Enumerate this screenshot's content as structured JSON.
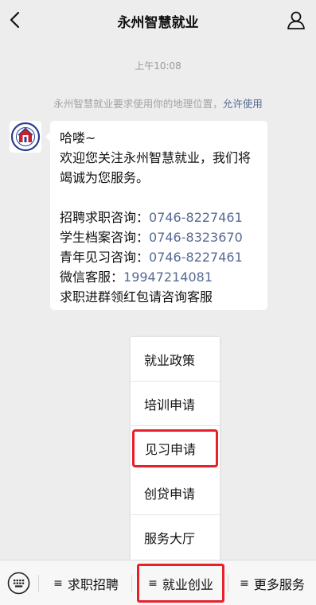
{
  "header": {
    "title": "永州智慧就业"
  },
  "chat": {
    "time": "上午10:08",
    "system_message": "永州智慧就业要求使用你的地理位置，",
    "system_action": "允许使用",
    "bubble": {
      "greeting": "哈喽~",
      "welcome_1": "欢迎您关注永州智慧就业，我们将",
      "welcome_2": "竭诚为您服务。",
      "lines": [
        {
          "label": "招聘求职咨询：",
          "value": "0746-8227461"
        },
        {
          "label": "学生档案咨询：",
          "value": "0746-8323670"
        },
        {
          "label": "青年见习咨询：",
          "value": "0746-8227461"
        },
        {
          "label": "微信客服：",
          "value": "19947214081"
        }
      ],
      "footer": "求职进群领红包请咨询客服"
    }
  },
  "submenu": {
    "items": [
      "就业政策",
      "培训申请",
      "见习申请",
      "创贷申请",
      "服务大厅"
    ]
  },
  "bottom_menu": {
    "tabs": [
      "求职招聘",
      "就业创业",
      "更多服务"
    ],
    "menu_glyph": "≡"
  },
  "colors": {
    "highlight": "#e8202a",
    "link": "#576b95",
    "background": "#ededed"
  },
  "icons": {
    "back": "back-chevron-icon",
    "profile": "person-icon",
    "keyboard": "keyboard-icon"
  }
}
